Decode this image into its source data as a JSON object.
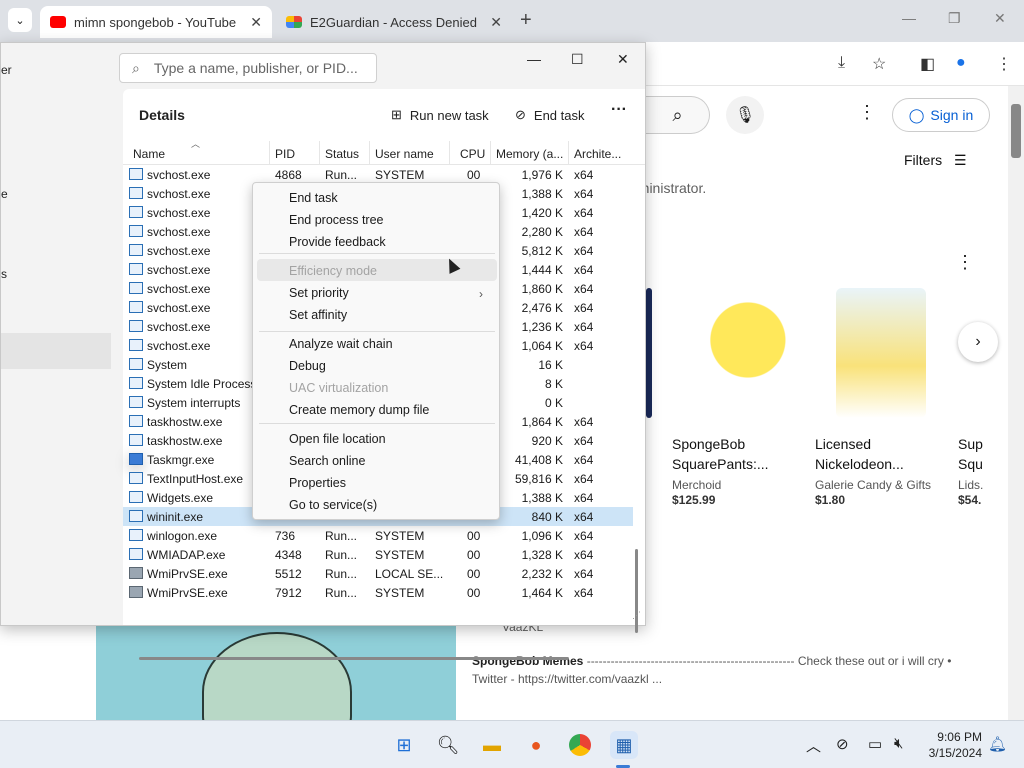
{
  "browser": {
    "tabs": [
      {
        "title": "mimn spongebob - YouTube",
        "active": true
      },
      {
        "title": "E2Guardian - Access Denied",
        "active": false
      }
    ],
    "new_tab": "+",
    "close": "✕"
  },
  "youtube": {
    "sign_in": "Sign in",
    "filters": "Filters",
    "admin_text": "dministrator.",
    "products": [
      {
        "title_line1": "SpongeBob",
        "title_line2": "SquarePants:...",
        "seller": "Merchoid",
        "price": "$125.99"
      },
      {
        "title_line1": "Licensed",
        "title_line2": "Nickelodeon...",
        "seller": "Galerie Candy & Gifts",
        "price": "$1.80"
      },
      {
        "title_line1": "Sup",
        "title_line2": "Squ",
        "seller": "Lids.",
        "price": "$54."
      }
    ],
    "meme_author": "VaazKL",
    "meme_title": "SpongeBob Memes",
    "meme_desc": " ---------------------------------------------------- Check these out or i will cry • Twitter - https://twitter.com/vaazkl ..."
  },
  "task_manager": {
    "sidebar_fragments": [
      "er",
      "e",
      "s"
    ],
    "search_placeholder": "Type a name, publisher, or PID...",
    "section_title": "Details",
    "run_new_task": "Run new task",
    "end_task": "End task",
    "columns": [
      "Name",
      "PID",
      "Status",
      "User name",
      "CPU",
      "Memory (a...",
      "Archite..."
    ],
    "rows": [
      {
        "name": "svchost.exe",
        "pid": "4868",
        "status": "Run...",
        "user": "SYSTEM",
        "cpu": "00",
        "mem": "1,976 K",
        "arch": "x64",
        "icon": "app"
      },
      {
        "name": "svchost.exe",
        "pid": "",
        "status": "",
        "user": "",
        "cpu": "",
        "mem": "1,388 K",
        "arch": "x64",
        "icon": "app"
      },
      {
        "name": "svchost.exe",
        "pid": "",
        "status": "",
        "user": "",
        "cpu": "",
        "mem": "1,420 K",
        "arch": "x64",
        "icon": "app"
      },
      {
        "name": "svchost.exe",
        "pid": "",
        "status": "",
        "user": "",
        "cpu": "",
        "mem": "2,280 K",
        "arch": "x64",
        "icon": "app"
      },
      {
        "name": "svchost.exe",
        "pid": "",
        "status": "",
        "user": "",
        "cpu": "",
        "mem": "5,812 K",
        "arch": "x64",
        "icon": "app"
      },
      {
        "name": "svchost.exe",
        "pid": "",
        "status": "",
        "user": "",
        "cpu": "",
        "mem": "1,444 K",
        "arch": "x64",
        "icon": "app"
      },
      {
        "name": "svchost.exe",
        "pid": "",
        "status": "",
        "user": "",
        "cpu": "",
        "mem": "1,860 K",
        "arch": "x64",
        "icon": "app"
      },
      {
        "name": "svchost.exe",
        "pid": "",
        "status": "",
        "user": "",
        "cpu": "",
        "mem": "2,476 K",
        "arch": "x64",
        "icon": "app"
      },
      {
        "name": "svchost.exe",
        "pid": "",
        "status": "",
        "user": "",
        "cpu": "",
        "mem": "1,236 K",
        "arch": "x64",
        "icon": "app"
      },
      {
        "name": "svchost.exe",
        "pid": "",
        "status": "",
        "user": "",
        "cpu": "",
        "mem": "1,064 K",
        "arch": "x64",
        "icon": "app"
      },
      {
        "name": "System",
        "pid": "",
        "status": "",
        "user": "",
        "cpu": "",
        "mem": "16 K",
        "arch": "",
        "icon": "app"
      },
      {
        "name": "System Idle Process",
        "pid": "",
        "status": "",
        "user": "",
        "cpu": "",
        "mem": "8 K",
        "arch": "",
        "icon": "app"
      },
      {
        "name": "System interrupts",
        "pid": "",
        "status": "",
        "user": "",
        "cpu": "",
        "mem": "0 K",
        "arch": "",
        "icon": "app"
      },
      {
        "name": "taskhostw.exe",
        "pid": "",
        "status": "",
        "user": "",
        "cpu": "",
        "mem": "1,864 K",
        "arch": "x64",
        "icon": "app"
      },
      {
        "name": "taskhostw.exe",
        "pid": "",
        "status": "",
        "user": "",
        "cpu": "",
        "mem": "920 K",
        "arch": "x64",
        "icon": "app"
      },
      {
        "name": "Taskmgr.exe",
        "pid": "",
        "status": "",
        "user": "",
        "cpu": "",
        "mem": "41,408 K",
        "arch": "x64",
        "icon": "tm"
      },
      {
        "name": "TextInputHost.exe",
        "pid": "",
        "status": "",
        "user": "",
        "cpu": "",
        "mem": "59,816 K",
        "arch": "x64",
        "icon": "app"
      },
      {
        "name": "Widgets.exe",
        "pid": "",
        "status": "",
        "user": "",
        "cpu": "",
        "mem": "1,388 K",
        "arch": "x64",
        "icon": "app"
      },
      {
        "name": "wininit.exe",
        "pid": "",
        "status": "",
        "user": "",
        "cpu": "",
        "mem": "840 K",
        "arch": "x64",
        "icon": "app",
        "selected": true
      },
      {
        "name": "winlogon.exe",
        "pid": "736",
        "status": "Run...",
        "user": "SYSTEM",
        "cpu": "00",
        "mem": "1,096 K",
        "arch": "x64",
        "icon": "app"
      },
      {
        "name": "WMIADAP.exe",
        "pid": "4348",
        "status": "Run...",
        "user": "SYSTEM",
        "cpu": "00",
        "mem": "1,328 K",
        "arch": "x64",
        "icon": "app"
      },
      {
        "name": "WmiPrvSE.exe",
        "pid": "5512",
        "status": "Run...",
        "user": "LOCAL SE...",
        "cpu": "00",
        "mem": "2,232 K",
        "arch": "x64",
        "icon": "wmi"
      },
      {
        "name": "WmiPrvSE.exe",
        "pid": "7912",
        "status": "Run...",
        "user": "SYSTEM",
        "cpu": "00",
        "mem": "1,464 K",
        "arch": "x64",
        "icon": "wmi"
      }
    ]
  },
  "context_menu": {
    "items": [
      {
        "label": "End task",
        "disabled": false
      },
      {
        "label": "End process tree",
        "disabled": false
      },
      {
        "label": "Provide feedback",
        "disabled": false
      },
      {
        "label": "Efficiency mode",
        "disabled": true
      },
      {
        "label": "Set priority",
        "disabled": false,
        "submenu": true
      },
      {
        "label": "Set affinity",
        "disabled": false
      },
      {
        "label": "Analyze wait chain",
        "disabled": false
      },
      {
        "label": "Debug",
        "disabled": false
      },
      {
        "label": "UAC virtualization",
        "disabled": true
      },
      {
        "label": "Create memory dump file",
        "disabled": false
      },
      {
        "label": "Open file location",
        "disabled": false
      },
      {
        "label": "Search online",
        "disabled": false
      },
      {
        "label": "Properties",
        "disabled": false
      },
      {
        "label": "Go to service(s)",
        "disabled": false
      }
    ]
  },
  "taskbar": {
    "time": "9:06 PM",
    "date": "3/15/2024"
  },
  "colors": {
    "youtube_red": "#ff0000",
    "link_blue": "#065fd4",
    "selection": "#cde4f7"
  }
}
